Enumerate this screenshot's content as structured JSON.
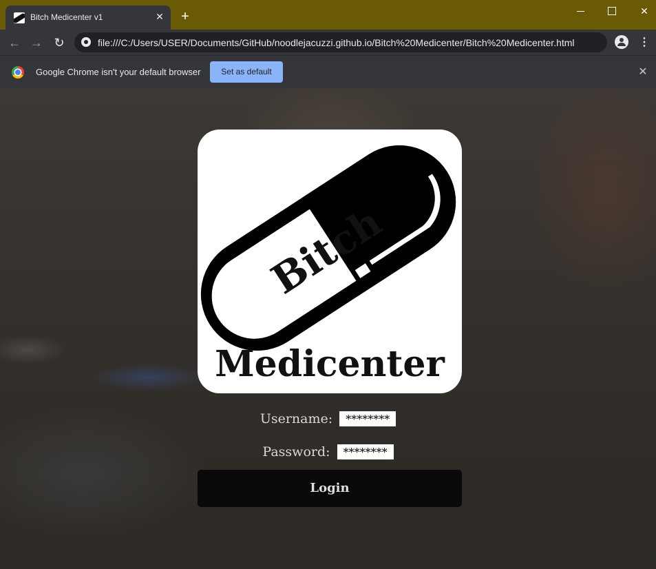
{
  "browser": {
    "tab_title": "Bitch Medicenter v1",
    "tab_close": "✕",
    "new_tab": "+",
    "url": "file:///C:/Users/USER/Documents/GitHub/noodlejacuzzi.github.io/Bitch%20Medicenter/Bitch%20Medicenter.html",
    "back": "←",
    "forward": "→",
    "reload": "↻",
    "menu": "⋮",
    "window_close": "✕",
    "frame_color": "#6b5a05"
  },
  "infobar": {
    "message": "Google Chrome isn't your default browser",
    "button_label": "Set as default",
    "close": "✕"
  },
  "page": {
    "logo": {
      "pill_text": "Bitch",
      "title_text": "Medicenter"
    },
    "form": {
      "username_label": "Username:",
      "username_value": "********",
      "password_label": "Password:",
      "password_value": "********",
      "login_label": "Login"
    }
  }
}
